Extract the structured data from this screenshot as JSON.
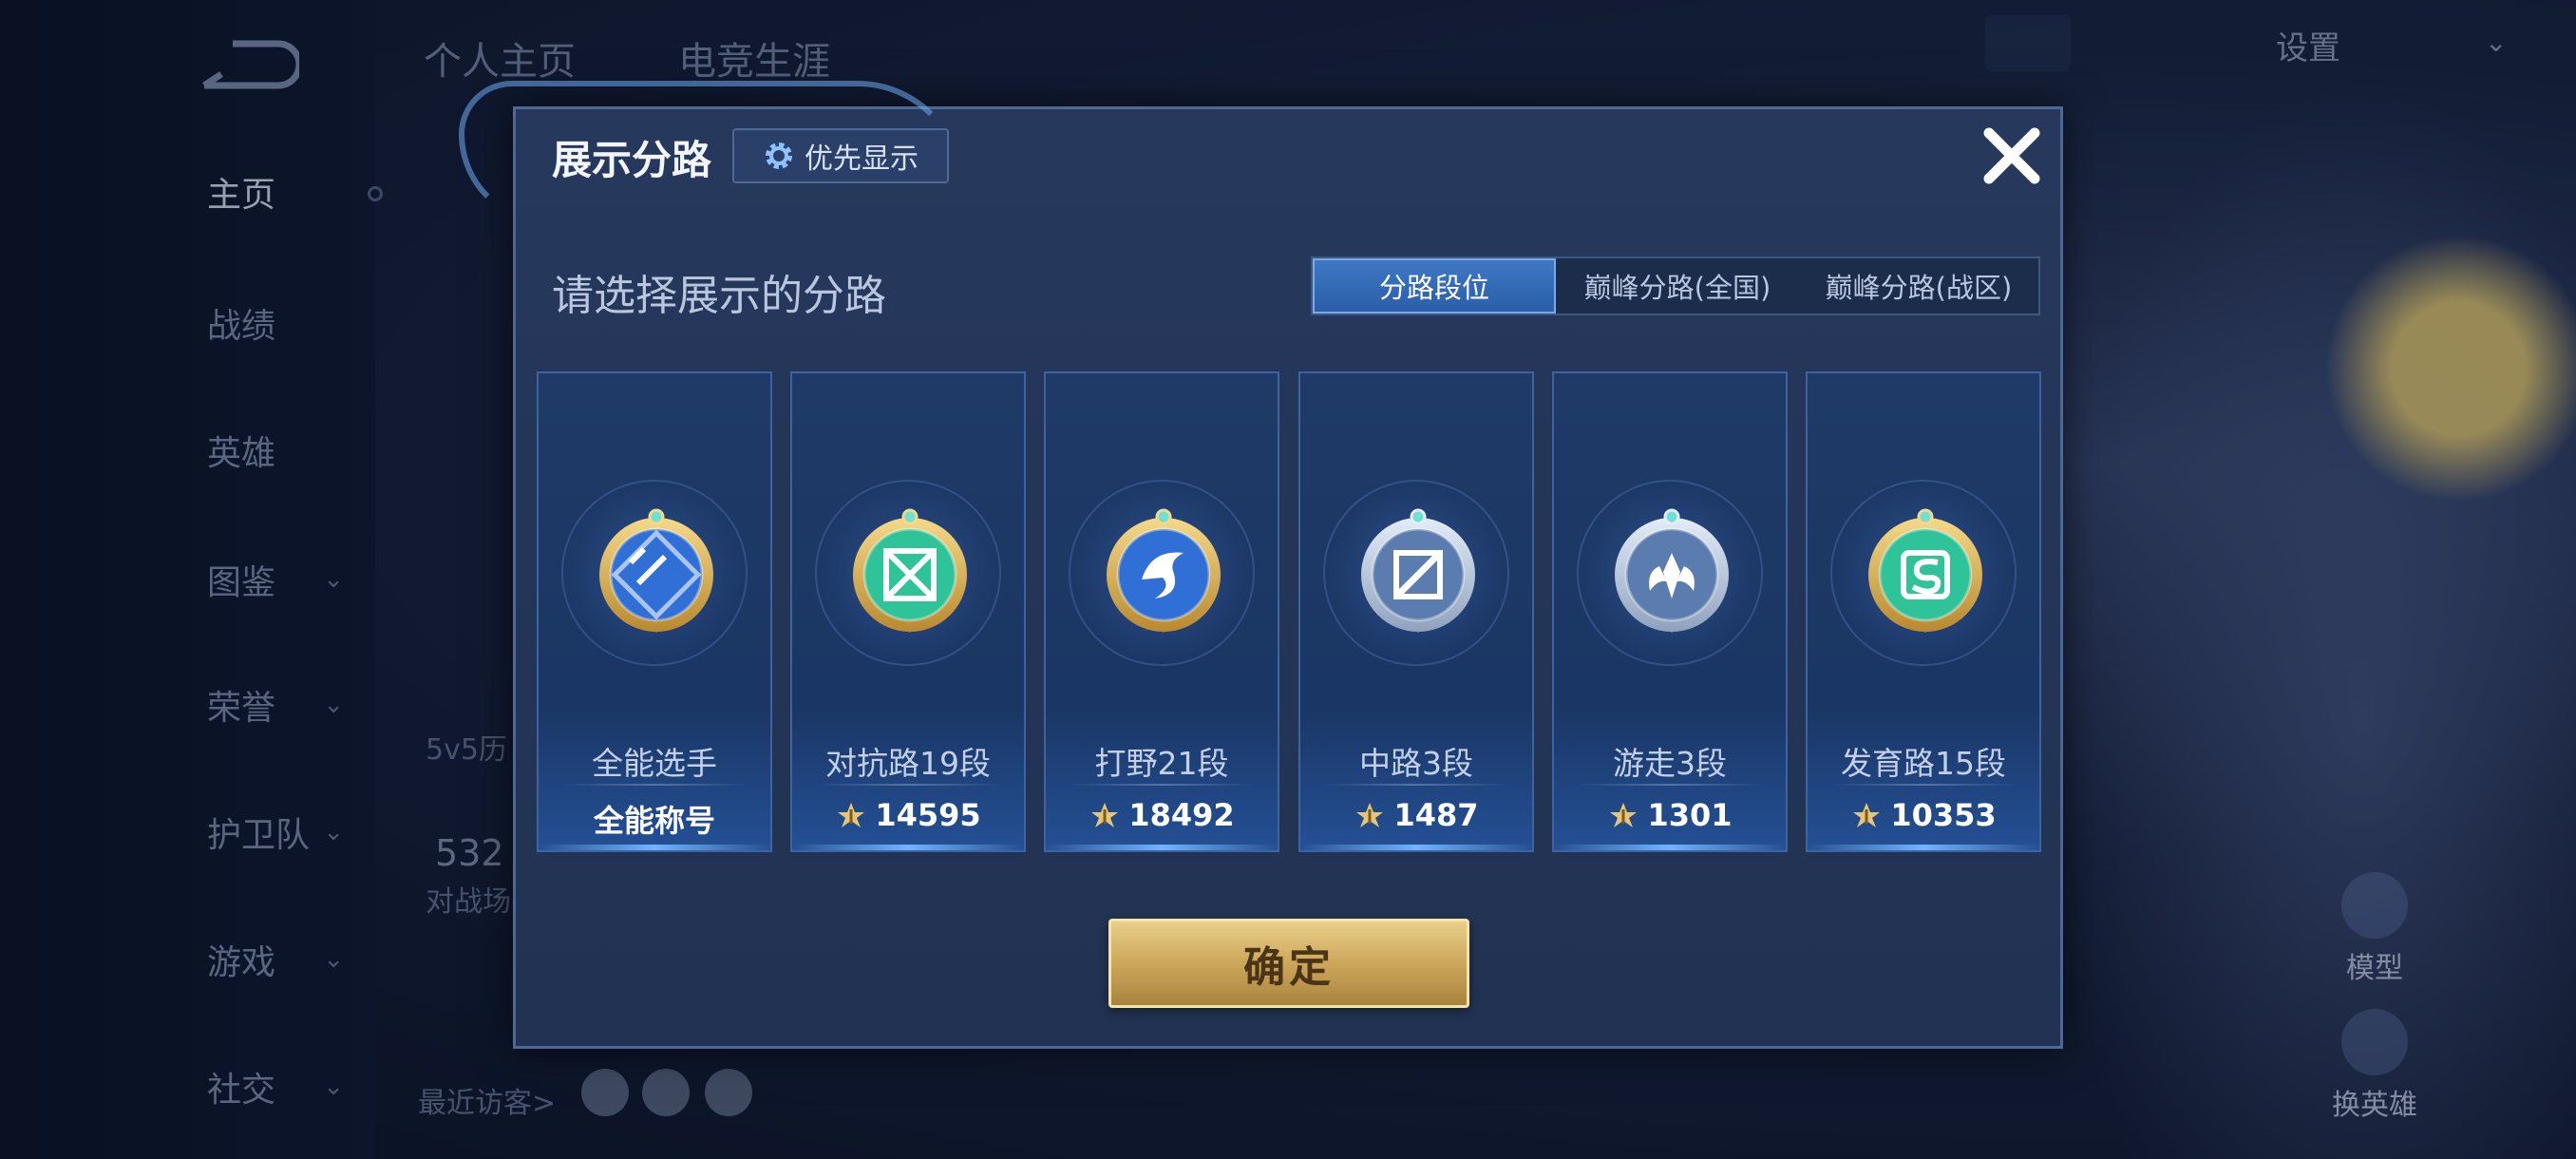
{
  "background": {
    "top_tabs": [
      "个人主页",
      "电竞生涯"
    ],
    "settings_label": "设置",
    "sidebar_items": [
      {
        "label": "主页",
        "active": true,
        "has_chevron": false
      },
      {
        "label": "战绩",
        "active": false,
        "has_chevron": false
      },
      {
        "label": "英雄",
        "active": false,
        "has_chevron": false
      },
      {
        "label": "图鉴",
        "active": false,
        "has_chevron": true
      },
      {
        "label": "荣誉",
        "active": false,
        "has_chevron": true
      },
      {
        "label": "护卫队",
        "active": false,
        "has_chevron": true
      },
      {
        "label": "游戏",
        "active": false,
        "has_chevron": true
      },
      {
        "label": "社交",
        "active": false,
        "has_chevron": true
      }
    ],
    "history_label": "5v5历",
    "battle_count": "532",
    "battle_label": "对战场",
    "recent_visitors_label": "最近访客>",
    "hero_buttons": {
      "model": "模型",
      "switch_hero": "换英雄"
    }
  },
  "modal": {
    "title": "展示分路",
    "priority_button": "优先显示",
    "subtitle": "请选择展示的分路",
    "tabs": [
      {
        "label": "分路段位",
        "active": true
      },
      {
        "label": "巅峰分路(全国)",
        "active": false
      },
      {
        "label": "巅峰分路(战区)",
        "active": false
      }
    ],
    "cards": [
      {
        "name": "全能选手",
        "value": "全能称号",
        "show_icon": false,
        "badge": "all-round",
        "rim": "gold",
        "core": "#2f6fd6"
      },
      {
        "name": "对抗路19段",
        "value": "14595",
        "show_icon": true,
        "badge": "clash-lane",
        "rim": "gold",
        "core": "#2fc39a"
      },
      {
        "name": "打野21段",
        "value": "18492",
        "show_icon": true,
        "badge": "jungle",
        "rim": "gold",
        "core": "#2f6fd6"
      },
      {
        "name": "中路3段",
        "value": "1487",
        "show_icon": true,
        "badge": "mid-lane",
        "rim": "silver",
        "core": "#5a7cae"
      },
      {
        "name": "游走3段",
        "value": "1301",
        "show_icon": true,
        "badge": "roam",
        "rim": "silver",
        "core": "#5a7cae"
      },
      {
        "name": "发育路15段",
        "value": "10353",
        "show_icon": true,
        "badge": "farm-lane",
        "rim": "gold",
        "core": "#2fc39a"
      }
    ],
    "confirm_label": "确定"
  }
}
